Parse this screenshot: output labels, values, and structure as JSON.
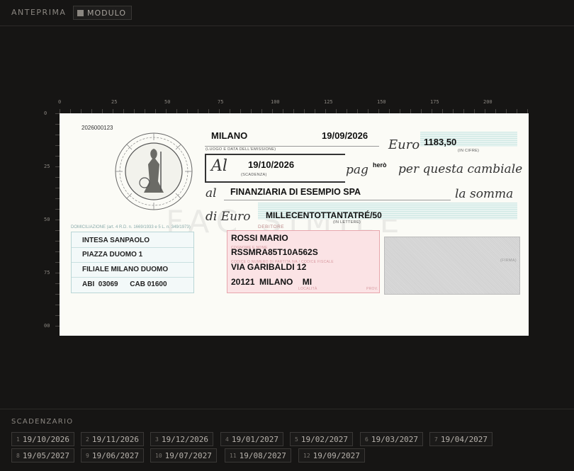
{
  "topbar": {
    "title": "ANTEPRIMA",
    "mode_label": "MODULO"
  },
  "ruler": {
    "top_labels": [
      "0",
      "25",
      "50",
      "75",
      "100",
      "125",
      "150",
      "175",
      "200"
    ],
    "left_labels": [
      "0",
      "25",
      "50",
      "75",
      "00"
    ]
  },
  "cheque": {
    "serial": "2026000123",
    "place": "MILANO",
    "issue_date": "19/09/2026",
    "place_caption": "(LUOGO E DATA DELL'EMISSIONE)",
    "euro_script": "Euro",
    "amount": "1183,50",
    "amount_caption": "(IN CIFRE)",
    "al_script": "Al",
    "due_date": "19/10/2026",
    "due_caption": "(SCADENZA)",
    "pag_script": "pag",
    "hero_text": "herò",
    "per_questa_script": "per questa cambiale",
    "al_payee_script": "al",
    "payee": "FINANZIARIA DI ESEMPIO SPA",
    "la_somma_script": "la somma",
    "di_euro_script": "di Euro",
    "amount_words": "MILLECENTOTTANTATRÉ/50",
    "words_caption": "(IN LETTERE)",
    "domiciliation_label": "DOMICILIAZIONE (art. 4 R.D. n. 1669/1933 e 5 L. n. 349/1973)",
    "bank": {
      "name": "INTESA SANPAOLO",
      "address": "PIAZZA DUOMO 1",
      "branch": "FILIALE MILANO DUOMO",
      "abi_cab": "ABI  03069      CAB 01600"
    },
    "debtor_label": "DEBITORE",
    "debtor": {
      "name": "ROSSI MARIO",
      "tax_code": "RSSMRA85T10A562S",
      "address": "VIA GARIBALDI 12",
      "city": "20121  MILANO    MI",
      "ghost_name": "COGNOME E NOME",
      "ghost_tax": "CODICE O NUMERO DI PARTITA IVA / CODICE FISCALE",
      "ghost_city": "LOCALITÀ",
      "ghost_prov": "PROV."
    },
    "stamp_caption": "(FIRMA)",
    "watermark": "FAC SIMILE"
  },
  "schedule": {
    "title": "SCADENZARIO",
    "items": [
      {
        "n": "1",
        "date": "19/10/2026"
      },
      {
        "n": "2",
        "date": "19/11/2026"
      },
      {
        "n": "3",
        "date": "19/12/2026"
      },
      {
        "n": "4",
        "date": "19/01/2027"
      },
      {
        "n": "5",
        "date": "19/02/2027"
      },
      {
        "n": "6",
        "date": "19/03/2027"
      },
      {
        "n": "7",
        "date": "19/04/2027"
      },
      {
        "n": "8",
        "date": "19/05/2027"
      },
      {
        "n": "9",
        "date": "19/06/2027"
      },
      {
        "n": "10",
        "date": "19/07/2027"
      },
      {
        "n": "11",
        "date": "19/08/2027"
      },
      {
        "n": "12",
        "date": "19/09/2027"
      }
    ]
  }
}
